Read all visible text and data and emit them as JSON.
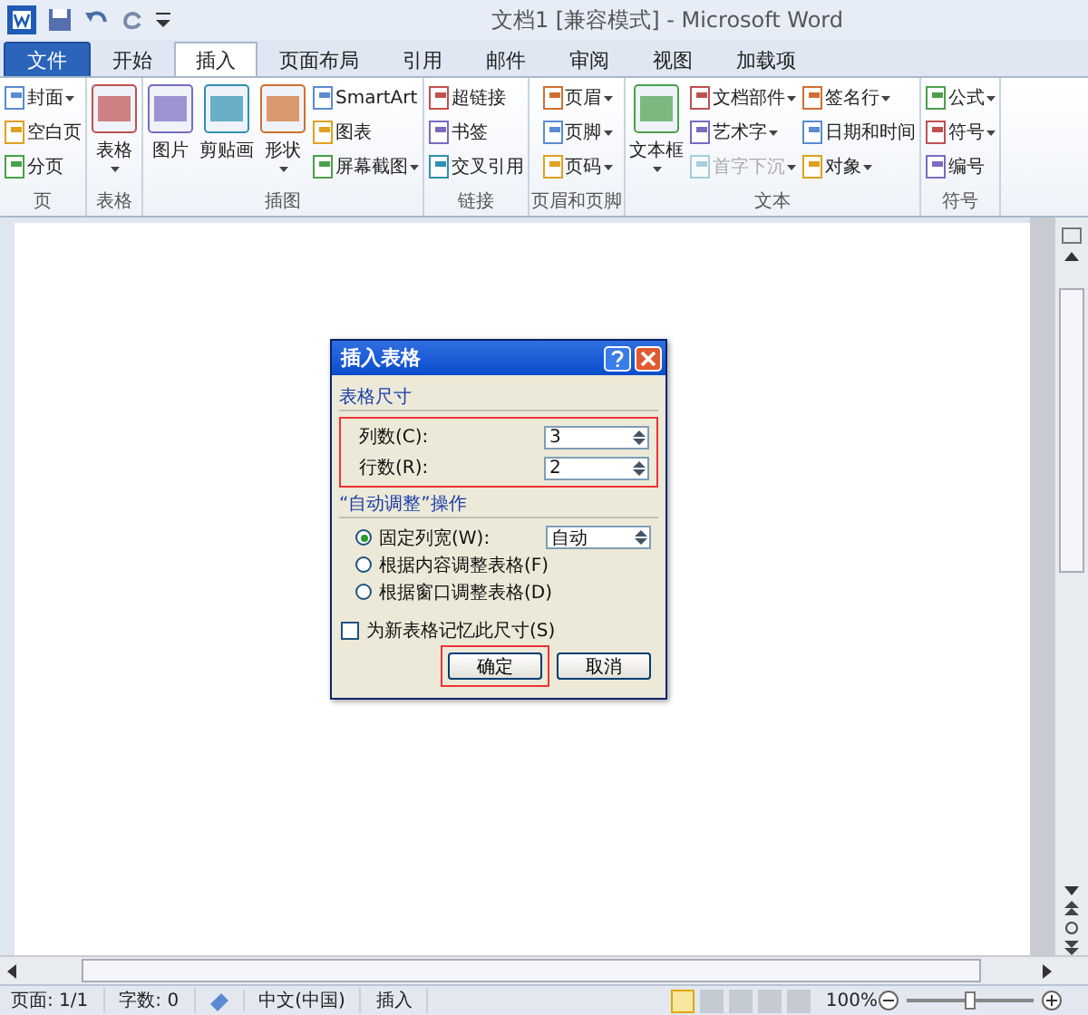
{
  "window": {
    "title": "文档1 [兼容模式] - Microsoft Word"
  },
  "tabs": [
    {
      "label": "文件",
      "kind": "file",
      "selected": false
    },
    {
      "label": "开始",
      "kind": "tab",
      "selected": false
    },
    {
      "label": "插入",
      "kind": "tab",
      "selected": true
    },
    {
      "label": "页面布局",
      "kind": "tab",
      "selected": false
    },
    {
      "label": "引用",
      "kind": "tab",
      "selected": false
    },
    {
      "label": "邮件",
      "kind": "tab",
      "selected": false
    },
    {
      "label": "审阅",
      "kind": "tab",
      "selected": false
    },
    {
      "label": "视图",
      "kind": "tab",
      "selected": false
    },
    {
      "label": "加载项",
      "kind": "tab",
      "selected": false
    }
  ],
  "ribbon_groups": [
    {
      "label": "页",
      "items": [
        {
          "label": "封面",
          "kind": "small",
          "dropdown": true,
          "disabled": false
        },
        {
          "label": "空白页",
          "kind": "small",
          "dropdown": false,
          "disabled": false
        },
        {
          "label": "分页",
          "kind": "small",
          "dropdown": false,
          "disabled": false
        }
      ]
    },
    {
      "label": "表格",
      "items": [
        {
          "label": "表格",
          "kind": "large",
          "dropdown": true,
          "disabled": false
        }
      ]
    },
    {
      "label": "插图",
      "items": [
        {
          "label": "图片",
          "kind": "large",
          "dropdown": false,
          "disabled": false
        },
        {
          "label": "剪贴画",
          "kind": "large",
          "dropdown": false,
          "disabled": false
        },
        {
          "label": "形状",
          "kind": "large",
          "dropdown": true,
          "disabled": false
        },
        {
          "label": "SmartArt",
          "kind": "small",
          "dropdown": false,
          "disabled": false
        },
        {
          "label": "图表",
          "kind": "small",
          "dropdown": false,
          "disabled": false
        },
        {
          "label": "屏幕截图",
          "kind": "small",
          "dropdown": true,
          "disabled": false
        }
      ]
    },
    {
      "label": "链接",
      "items": [
        {
          "label": "超链接",
          "kind": "small",
          "dropdown": false,
          "disabled": false
        },
        {
          "label": "书签",
          "kind": "small",
          "dropdown": false,
          "disabled": false
        },
        {
          "label": "交叉引用",
          "kind": "small",
          "dropdown": false,
          "disabled": false
        }
      ]
    },
    {
      "label": "页眉和页脚",
      "items": [
        {
          "label": "页眉",
          "kind": "small",
          "dropdown": true,
          "disabled": false
        },
        {
          "label": "页脚",
          "kind": "small",
          "dropdown": true,
          "disabled": false
        },
        {
          "label": "页码",
          "kind": "small",
          "dropdown": true,
          "disabled": false
        }
      ]
    },
    {
      "label": "文本",
      "items": [
        {
          "label": "文本框",
          "kind": "large",
          "dropdown": true,
          "disabled": false
        },
        {
          "label": "文档部件",
          "kind": "small",
          "dropdown": true,
          "disabled": false
        },
        {
          "label": "艺术字",
          "kind": "small",
          "dropdown": true,
          "disabled": false
        },
        {
          "label": "首字下沉",
          "kind": "small",
          "dropdown": true,
          "disabled": true
        },
        {
          "label": "签名行",
          "kind": "small",
          "dropdown": true,
          "disabled": false
        },
        {
          "label": "日期和时间",
          "kind": "small",
          "dropdown": false,
          "disabled": false
        },
        {
          "label": "对象",
          "kind": "small",
          "dropdown": true,
          "disabled": false
        }
      ]
    },
    {
      "label": "符号",
      "items": [
        {
          "label": "公式",
          "kind": "small",
          "dropdown": true,
          "disabled": false
        },
        {
          "label": "符号",
          "kind": "small",
          "dropdown": true,
          "disabled": false
        },
        {
          "label": "编号",
          "kind": "small",
          "dropdown": false,
          "disabled": false
        }
      ]
    }
  ],
  "dialog": {
    "title": "插入表格",
    "size_heading": "表格尺寸",
    "fields_highlighted": true,
    "fields": [
      {
        "label": "列数(C):",
        "value": "3"
      },
      {
        "label": "行数(R):",
        "value": "2"
      }
    ],
    "autofit_heading": "“自动调整”操作",
    "options": [
      {
        "label": "固定列宽(W):",
        "selected": true,
        "value": "自动"
      },
      {
        "label": "根据内容调整表格(F)",
        "selected": false
      },
      {
        "label": "根据窗口调整表格(D)",
        "selected": false
      }
    ],
    "remember": {
      "label": "为新表格记忆此尺寸(S)",
      "checked": false
    },
    "buttons": [
      {
        "label": "确定",
        "highlighted": true
      },
      {
        "label": "取消",
        "highlighted": false
      }
    ]
  },
  "status_bar": {
    "items": [
      "页面: 1/1",
      "字数: 0",
      "中文(中国)",
      "插入"
    ],
    "views": [
      {
        "selected": true
      },
      {
        "selected": false
      },
      {
        "selected": false
      },
      {
        "selected": false
      },
      {
        "selected": false
      }
    ],
    "zoom": "100%",
    "zoom_level": {
      "level": 0.5
    }
  }
}
